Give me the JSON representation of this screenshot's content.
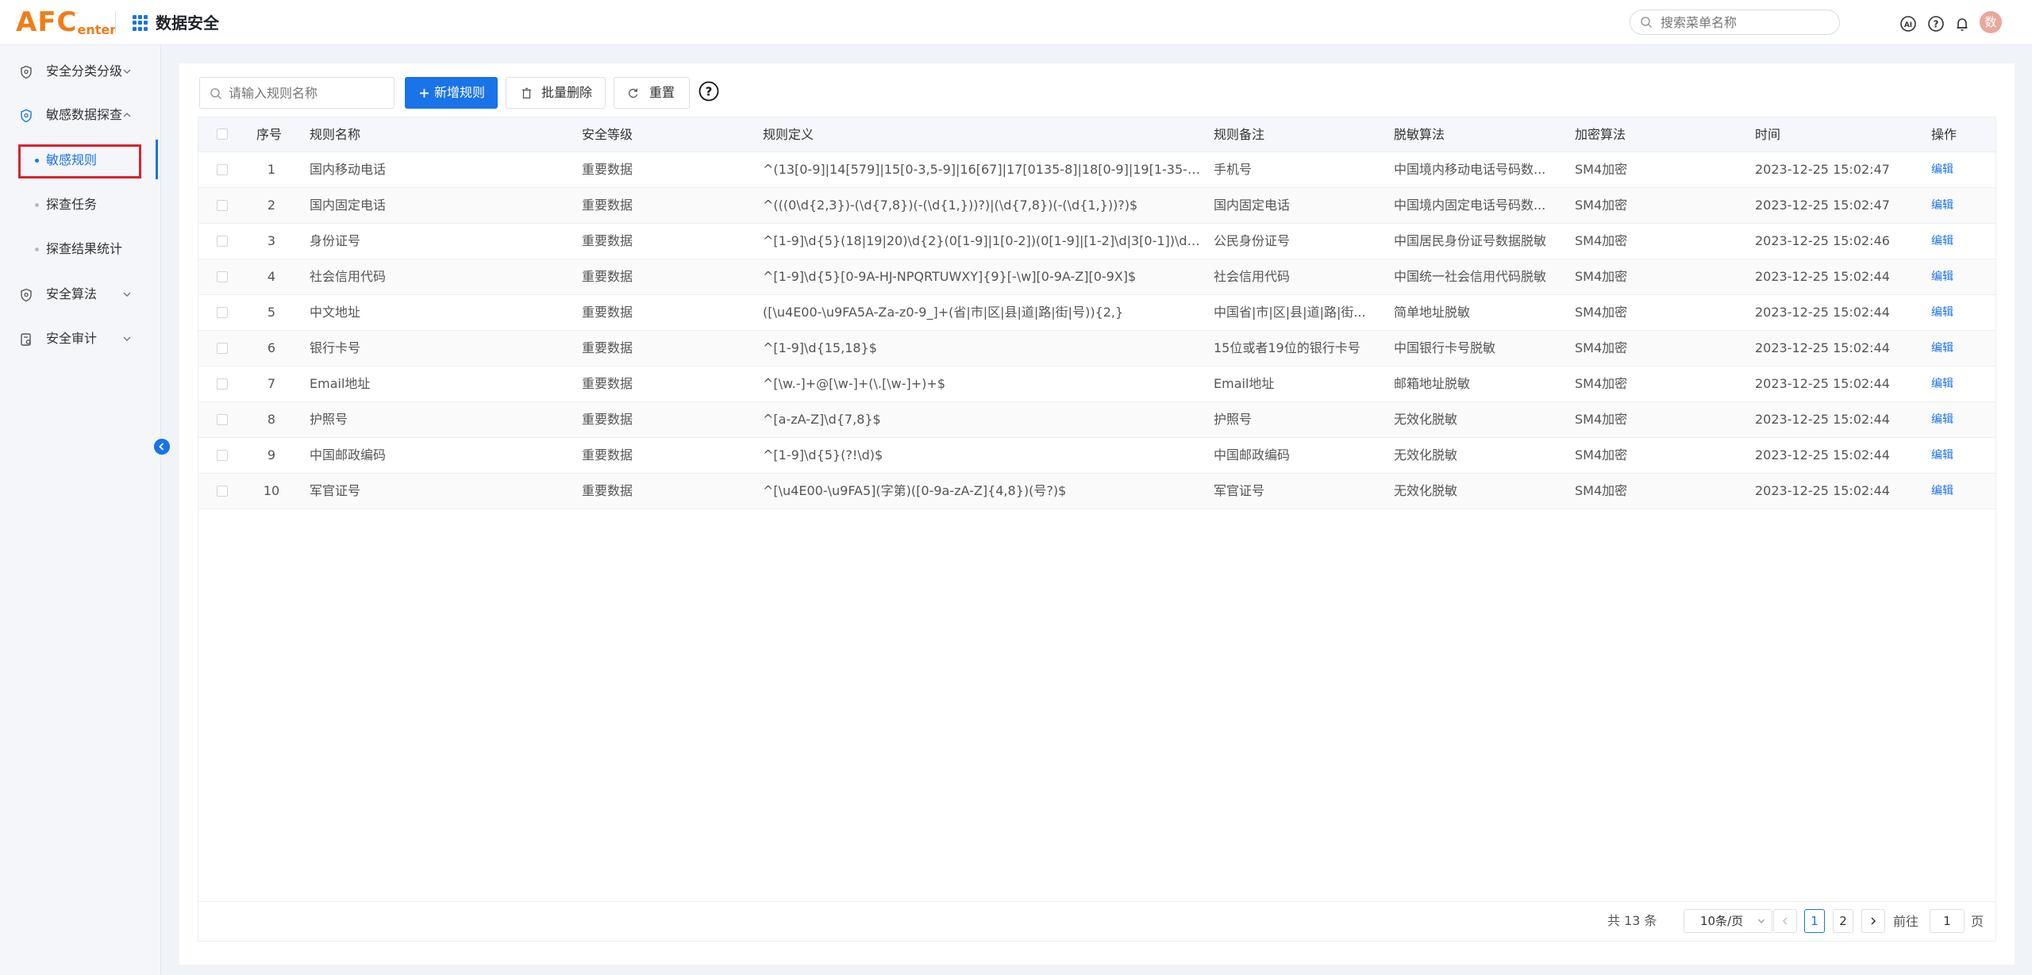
{
  "header": {
    "logo_main": "AFC",
    "logo_sub": "enter",
    "app_title": "数据安全",
    "search_placeholder": "搜索菜单名称",
    "avatar_text": "数"
  },
  "sidebar": {
    "items": [
      {
        "label": "安全分类分级"
      },
      {
        "label": "敏感数据探查"
      },
      {
        "label": "安全算法"
      },
      {
        "label": "安全审计"
      }
    ],
    "sub_items": [
      {
        "label": "敏感规则"
      },
      {
        "label": "探查任务"
      },
      {
        "label": "探查结果统计"
      }
    ]
  },
  "toolbar": {
    "search_placeholder": "请输入规则名称",
    "add_label": "新增规则",
    "batch_delete_label": "批量删除",
    "reset_label": "重置"
  },
  "table": {
    "columns": [
      "序号",
      "规则名称",
      "安全等级",
      "规则定义",
      "规则备注",
      "脱敏算法",
      "加密算法",
      "时间",
      "操作"
    ],
    "rows": [
      {
        "no": "1",
        "name": "国内移动电话",
        "level": "重要数据",
        "def": "^(13[0-9]|14[579]|15[0-3,5-9]|16[67]|17[0135-8]|18[0-9]|19[1-35-9])\\d...",
        "note": "手机号",
        "mask": "中国境内移动电话号码数...",
        "enc": "SM4加密",
        "time": "2023-12-25 15:02:47",
        "op": "编辑"
      },
      {
        "no": "2",
        "name": "国内固定电话",
        "level": "重要数据",
        "def": "^(((0\\d{2,3})-(\\d{7,8})(-(\\d{1,}))?)|(\\d{7,8})(-(\\d{1,}))?)$",
        "note": "国内固定电话",
        "mask": "中国境内固定电话号码数...",
        "enc": "SM4加密",
        "time": "2023-12-25 15:02:47",
        "op": "编辑"
      },
      {
        "no": "3",
        "name": "身份证号",
        "level": "重要数据",
        "def": "^[1-9]\\d{5}(18|19|20)\\d{2}(0[1-9]|1[0-2])(0[1-9]|[1-2]\\d|3[0-1])\\d{3}([...",
        "note": "公民身份证号",
        "mask": "中国居民身份证号数据脱敏",
        "enc": "SM4加密",
        "time": "2023-12-25 15:02:46",
        "op": "编辑"
      },
      {
        "no": "4",
        "name": "社会信用代码",
        "level": "重要数据",
        "def": "^[1-9]\\d{5}[0-9A-HJ-NPQRTUWXY]{9}[-\\w][0-9A-Z][0-9X]$",
        "note": "社会信用代码",
        "mask": "中国统一社会信用代码脱敏",
        "enc": "SM4加密",
        "time": "2023-12-25 15:02:44",
        "op": "编辑"
      },
      {
        "no": "5",
        "name": "中文地址",
        "level": "重要数据",
        "def": "([\\u4E00-\\u9FA5A-Za-z0-9_]+(省|市|区|县|道|路|街|号)){2,}",
        "note": "中国省|市|区|县|道|路|街...",
        "mask": "简单地址脱敏",
        "enc": "SM4加密",
        "time": "2023-12-25 15:02:44",
        "op": "编辑"
      },
      {
        "no": "6",
        "name": "银行卡号",
        "level": "重要数据",
        "def": "^[1-9]\\d{15,18}$",
        "note": "15位或者19位的银行卡号",
        "mask": "中国银行卡号脱敏",
        "enc": "SM4加密",
        "time": "2023-12-25 15:02:44",
        "op": "编辑"
      },
      {
        "no": "7",
        "name": "Email地址",
        "level": "重要数据",
        "def": "^[\\w.-]+@[\\w-]+(\\.[\\w-]+)+$",
        "note": "Email地址",
        "mask": "邮箱地址脱敏",
        "enc": "SM4加密",
        "time": "2023-12-25 15:02:44",
        "op": "编辑"
      },
      {
        "no": "8",
        "name": "护照号",
        "level": "重要数据",
        "def": "^[a-zA-Z]\\d{7,8}$",
        "note": "护照号",
        "mask": "无效化脱敏",
        "enc": "SM4加密",
        "time": "2023-12-25 15:02:44",
        "op": "编辑"
      },
      {
        "no": "9",
        "name": "中国邮政编码",
        "level": "重要数据",
        "def": "^[1-9]\\d{5}(?!\\d)$",
        "note": "中国邮政编码",
        "mask": "无效化脱敏",
        "enc": "SM4加密",
        "time": "2023-12-25 15:02:44",
        "op": "编辑"
      },
      {
        "no": "10",
        "name": "军官证号",
        "level": "重要数据",
        "def": "^[\\u4E00-\\u9FA5](字第)([0-9a-zA-Z]{4,8})(号?)$",
        "note": "军官证号",
        "mask": "无效化脱敏",
        "enc": "SM4加密",
        "time": "2023-12-25 15:02:44",
        "op": "编辑"
      }
    ]
  },
  "pagination": {
    "total_text": "共 13 条",
    "page_size": "10条/页",
    "pages": [
      "1",
      "2"
    ],
    "current_page": "1",
    "goto_label": "前往",
    "goto_value": "1",
    "page_suffix": "页"
  },
  "colors": {
    "accent": "#1a73e8",
    "logo": "#f07d19",
    "highlight": "#d9232e"
  }
}
